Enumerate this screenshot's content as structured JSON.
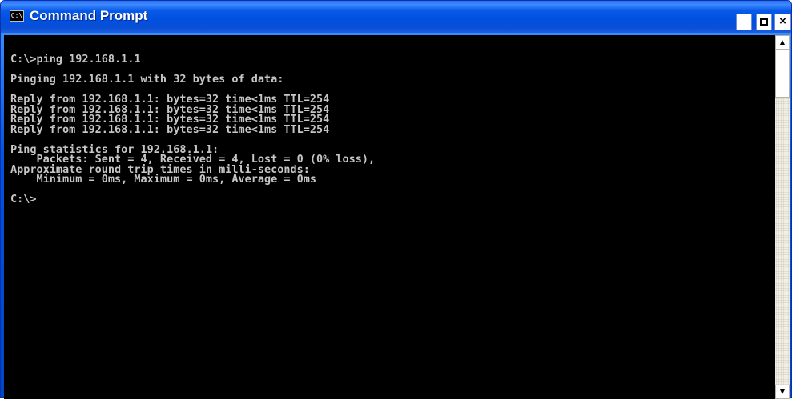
{
  "window": {
    "title": "Command Prompt",
    "icon": "console-icon",
    "icon_glyph": "C:\\",
    "controls": {
      "minimize_glyph": "_",
      "close_glyph": "×"
    }
  },
  "console": {
    "lines": [
      "C:\\>ping 192.168.1.1",
      "",
      "Pinging 192.168.1.1 with 32 bytes of data:",
      "",
      "Reply from 192.168.1.1: bytes=32 time<1ms TTL=254",
      "Reply from 192.168.1.1: bytes=32 time<1ms TTL=254",
      "Reply from 192.168.1.1: bytes=32 time<1ms TTL=254",
      "Reply from 192.168.1.1: bytes=32 time<1ms TTL=254",
      "",
      "Ping statistics for 192.168.1.1:",
      "    Packets: Sent = 4, Received = 4, Lost = 0 (0% loss),",
      "Approximate round trip times in milli-seconds:",
      "    Minimum = 0ms, Maximum = 0ms, Average = 0ms",
      "",
      "C:\\>"
    ]
  },
  "scrollbar": {
    "position": 0,
    "up_glyph": "▲",
    "down_glyph": "▼"
  },
  "colors": {
    "titlebar": "#0a5ae8",
    "console_background": "#000000",
    "console_text": "#c6c6c6"
  }
}
